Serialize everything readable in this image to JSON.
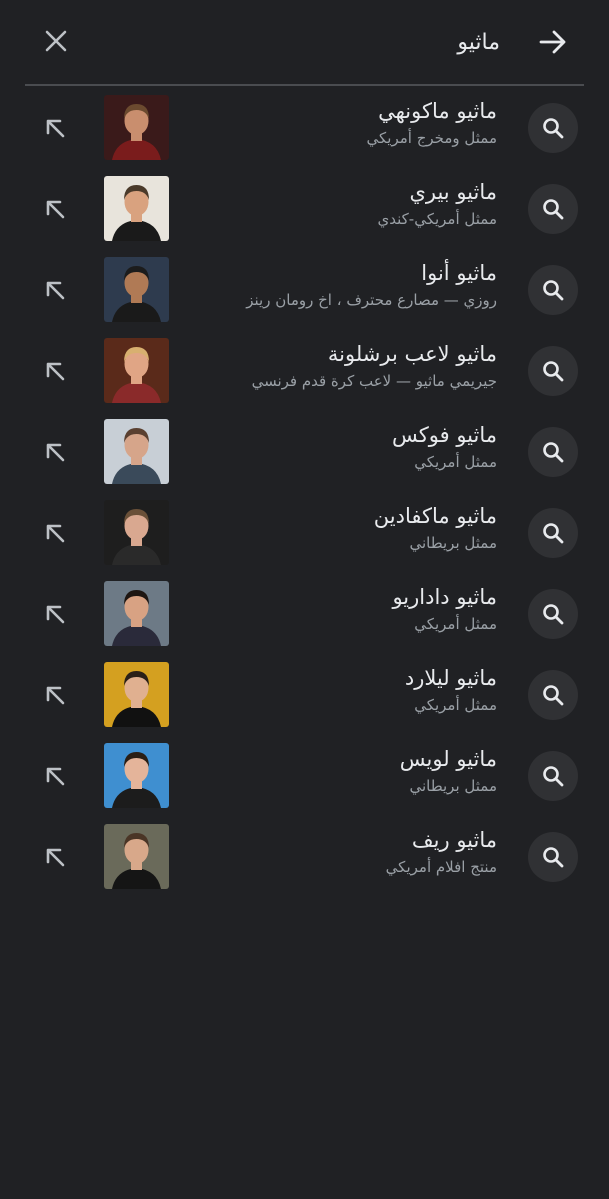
{
  "search": {
    "query": "ماثيو"
  },
  "header": {
    "close_icon": "close-icon",
    "go_icon": "arrow-right-icon"
  },
  "suggestions": [
    {
      "title": "ماثيو ماكونهي",
      "subtitle": "ممثل ومخرج أمريكي",
      "thumb_bg": "#3a1a1a",
      "skin": "#c98e6e",
      "hair": "#6b4a2f",
      "shirt": "#7a1c1c"
    },
    {
      "title": "ماثيو بيري",
      "subtitle": "ممثل أمريكي-كندي",
      "thumb_bg": "#e8e4dc",
      "skin": "#d9a27f",
      "hair": "#4a3a2a",
      "shirt": "#1a1a1a"
    },
    {
      "title": "ماثيو أنوا",
      "subtitle": "روزي — مصارع محترف ، اخ رومان رينز",
      "thumb_bg": "#2e3b4e",
      "skin": "#b07a55",
      "hair": "#1c1c1c",
      "shirt": "#1a1a1a"
    },
    {
      "title": "ماثيو لاعب برشلونة",
      "subtitle": "جيريمي ماثيو — لاعب كرة قدم فرنسي",
      "thumb_bg": "#5a2a1a",
      "skin": "#e0a585",
      "hair": "#d8b070",
      "shirt": "#8a2a2a"
    },
    {
      "title": "ماثيو فوكس",
      "subtitle": "ممثل أمريكي",
      "thumb_bg": "#c8cfd6",
      "skin": "#d6a58a",
      "hair": "#5a4030",
      "shirt": "#3a4a5a"
    },
    {
      "title": "ماثيو ماكفادين",
      "subtitle": "ممثل بريطاني",
      "thumb_bg": "#1e1e1e",
      "skin": "#d9a890",
      "hair": "#6a5038",
      "shirt": "#2a2a2a"
    },
    {
      "title": "ماثيو داداريو",
      "subtitle": "ممثل أمريكي",
      "thumb_bg": "#6d7a86",
      "skin": "#d8a283",
      "hair": "#1e1612",
      "shirt": "#2a2a3a"
    },
    {
      "title": "ماثيو ليلارد",
      "subtitle": "ممثل أمريكي",
      "thumb_bg": "#d4a020",
      "skin": "#e0b090",
      "hair": "#2a2018",
      "shirt": "#111111"
    },
    {
      "title": "ماثيو لويس",
      "subtitle": "ممثل بريطاني",
      "thumb_bg": "#3f8fd0",
      "skin": "#e4b49a",
      "hair": "#2a1e14",
      "shirt": "#1c1c1c"
    },
    {
      "title": "ماثيو ريف",
      "subtitle": "منتج افلام أمريكي",
      "thumb_bg": "#6a6a5a",
      "skin": "#d8a88a",
      "hair": "#4a3526",
      "shirt": "#151515"
    }
  ]
}
